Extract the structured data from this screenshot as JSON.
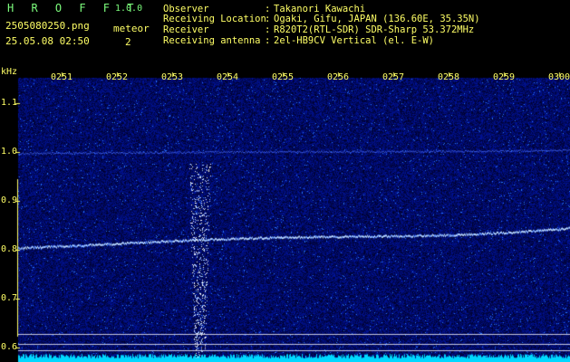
{
  "header": {
    "app_name": "H R O F F T",
    "app_version": "1.0.0",
    "file_name": "2505080250.png",
    "date_time": "25.05.08 02:50",
    "meteor_label": "meteor",
    "meteor_count": "2"
  },
  "info": [
    {
      "key": "Observer",
      "value": "Takanori Kawachi"
    },
    {
      "key": "Receiving Location",
      "value": "Ogaki, Gifu, JAPAN (136.60E, 35.35N)"
    },
    {
      "key": "Receiver",
      "value": "R820T2(RTL-SDR) SDR-Sharp 53.372MHz"
    },
    {
      "key": "Receiving antenna",
      "value": "2el-HB9CV Vertical (el. E-W)"
    }
  ],
  "chart_data": {
    "type": "heatmap",
    "unit_label": "kHz",
    "x_ticks": [
      "0251",
      "0252",
      "0253",
      "0254",
      "0255",
      "0256",
      "0257",
      "0258",
      "0259",
      "0300"
    ],
    "y_ticks": [
      "1.1",
      "1.0",
      "0.9",
      "0.8",
      "0.7",
      "0.6"
    ],
    "ylim": [
      0.57,
      1.16
    ],
    "traces": [
      {
        "kind": "carrier",
        "start_khz": 0.805,
        "end_khz": 0.848
      },
      {
        "kind": "faint-carrier",
        "start_khz": 0.998,
        "end_khz": 1.005
      }
    ],
    "meteor_echo_time": "0253.5"
  },
  "colors": {
    "background": "#000000",
    "noise": "#1010a0",
    "trace": "#a0c8ff",
    "baseline": "#00d8ff",
    "label": "#FFFF66",
    "title": "#7CFC7C"
  }
}
